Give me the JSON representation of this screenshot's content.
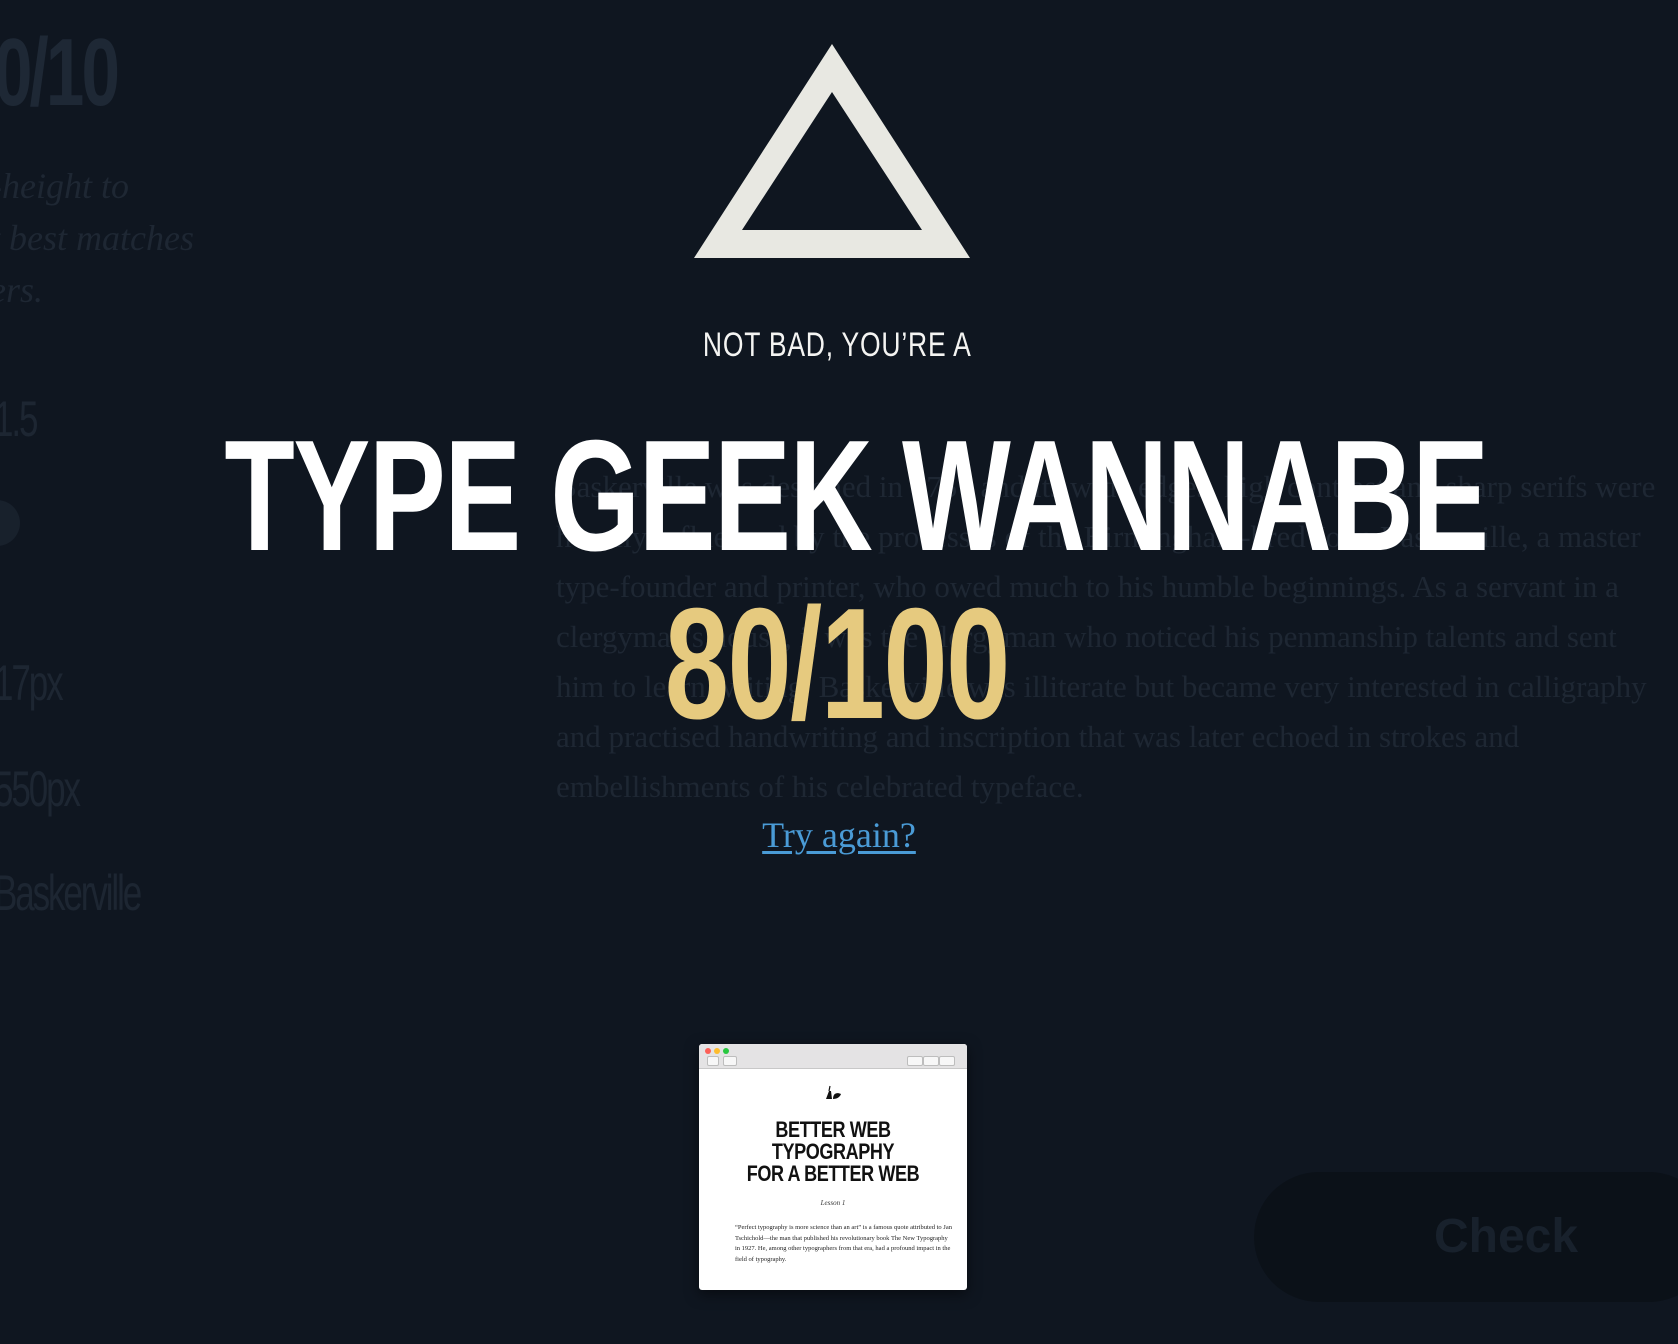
{
  "background": {
    "score_fragment": "0/10",
    "question_lines": [
      "-height to",
      "t best matches",
      "ers."
    ],
    "options": [
      "1.5",
      "17px",
      "550px",
      "Baskerville"
    ],
    "paragraph": "Baskerville was designed in 1757 and its wide edges, high contrast and sharp serifs were heavily influenced by the processes of the Birmingham-bred John Baskerville, a master type-founder and printer, who owed much to his humble beginnings. As a servant in a clergyman's house, it was the clergyman who noticed his penmanship talents and sent him to learn writing. Baskerville was illiterate but became very interested in calligraphy and practised handwriting and inscription that was later echoed in strokes and embellishments of his celebrated typeface.",
    "check_button": "Check"
  },
  "result": {
    "icon": "triangle-icon",
    "intro": "NOT BAD, YOU’RE A",
    "rank": "TYPE GEEK WANNABE",
    "score": "80/100",
    "try_again": "Try again?"
  },
  "book": {
    "logo_icon": "typewriter-logo-icon",
    "title_line1": "BETTER WEB TYPOGRAPHY",
    "title_line2": "FOR A BETTER WEB",
    "lesson": "Lesson 1",
    "quote": "“Perfect typography is more science than an art” is a famous quote attributed to Jan Tschichold—the man that published his revolutionary book The New Typography in 1927. He, among other typographers from that era, had a profound impact in the field of typography."
  },
  "colors": {
    "background": "#0f1620",
    "score": "#e6ca7f",
    "link": "#4a9bd6",
    "triangle": "#e8e8e2",
    "text": "#ffffff"
  }
}
